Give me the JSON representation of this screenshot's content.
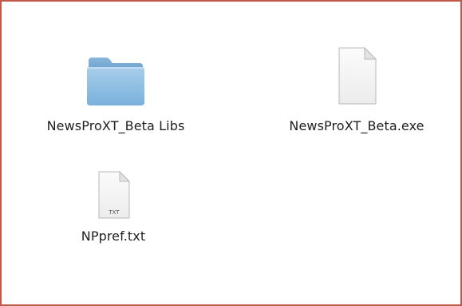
{
  "window": {
    "border_color": "#c0594a",
    "background": "#ffffff"
  },
  "items": [
    {
      "label": "NewsProXT_Beta Libs",
      "icon": "folder-icon",
      "kind": "folder"
    },
    {
      "label": "NewsProXT_Beta.exe",
      "icon": "document-icon",
      "kind": "file"
    },
    {
      "label": "NPpref.txt",
      "icon": "txt-file-icon",
      "kind": "text-file",
      "badge": "TXT"
    }
  ]
}
